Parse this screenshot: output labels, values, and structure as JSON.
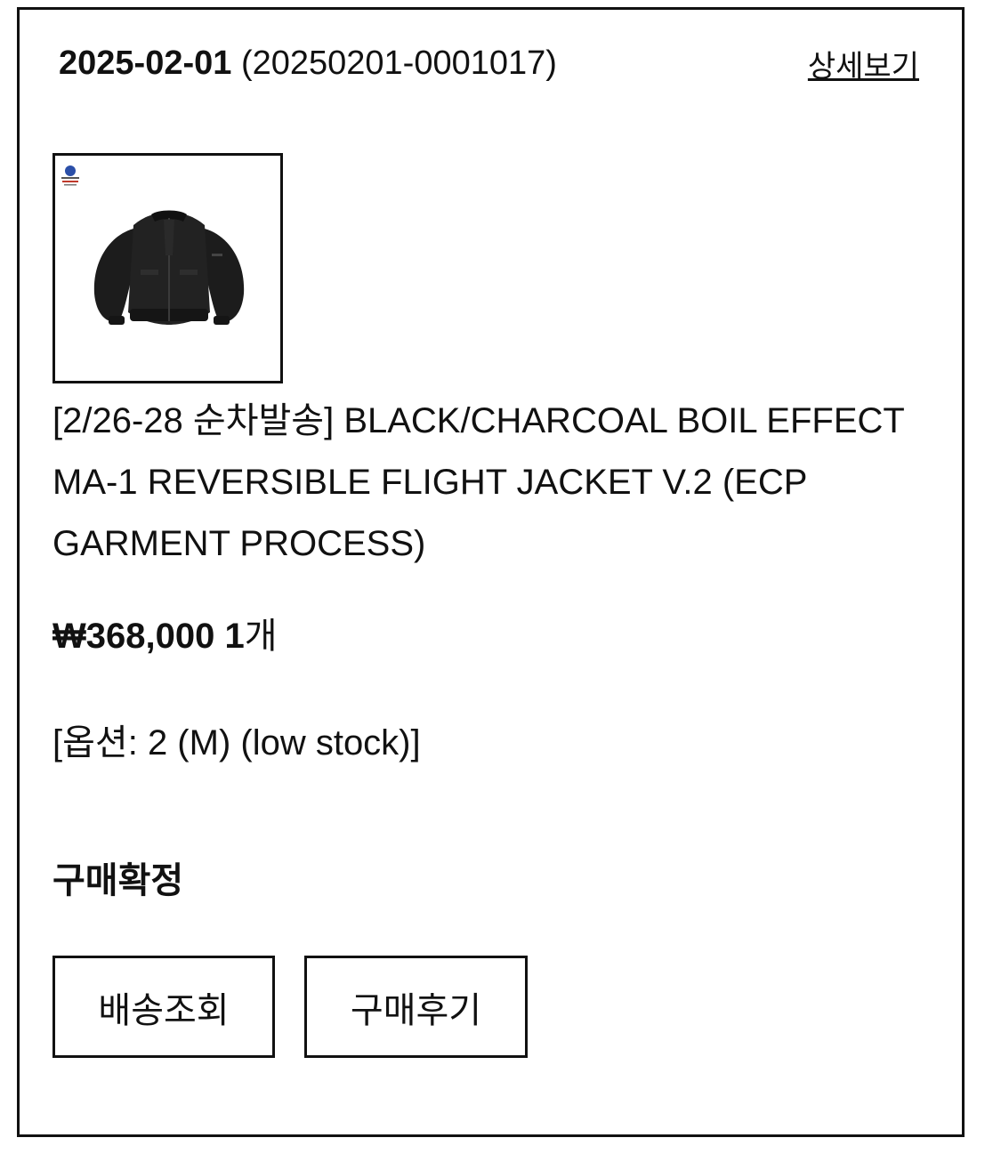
{
  "order": {
    "date": "2025-02-01",
    "number": "(20250201-0001017)",
    "detail_link": "상세보기"
  },
  "product": {
    "image_icon": "jacket-product-image",
    "name": "[2/26-28 순차발송] BLACK/CHARCOAL BOIL EFFECT MA-1 REVERSIBLE FLIGHT JACKET V.2 (ECP GARMENT PROCESS)",
    "price": "₩368,000",
    "quantity_number": "1",
    "quantity_unit": "개",
    "option": "[옵션: 2 (M) (low stock)]"
  },
  "status": "구매확정",
  "buttons": {
    "delivery": "배송조회",
    "review": "구매후기"
  },
  "colors": {
    "border": "#111111",
    "text": "#111111",
    "background": "#ffffff"
  }
}
